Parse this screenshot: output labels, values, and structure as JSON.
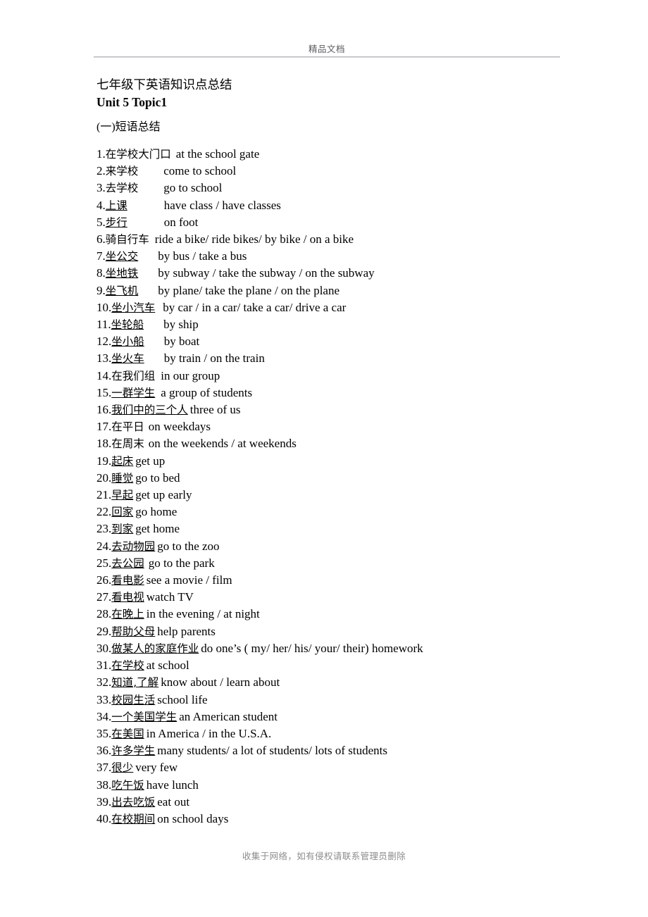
{
  "header": {
    "title": "精品文档"
  },
  "document": {
    "title": "七年级下英语知识点总结",
    "subtitle": "Unit 5 Topic1",
    "section_heading": "(一)短语总结"
  },
  "phrases": [
    {
      "num": "1.",
      "cn": "在学校大门口",
      "underline": false,
      "gap": 7,
      "en": "at the school gate"
    },
    {
      "num": "2.",
      "cn": "来学校",
      "underline": false,
      "gap": 36,
      "en": "come to school"
    },
    {
      "num": "3.",
      "cn": "去学校",
      "underline": false,
      "gap": 36,
      "en": "go to school"
    },
    {
      "num": "4.",
      "cn": "上课",
      "underline": true,
      "gap": 52,
      "en": "have class / have classes"
    },
    {
      "num": "5.",
      "cn": "步行",
      "underline": true,
      "gap": 52,
      "en": "on foot"
    },
    {
      "num": "6.",
      "cn": "骑自行车",
      "underline": false,
      "gap": 8,
      "en": "ride a bike/ ride bikes/ by bike / on a bike"
    },
    {
      "num": "7.",
      "cn": "坐公交",
      "underline": true,
      "gap": 28,
      "en": "by bus / take a bus"
    },
    {
      "num": "8.",
      "cn": "坐地铁",
      "underline": true,
      "gap": 28,
      "en": "by subway / take the subway / on the subway"
    },
    {
      "num": "9.",
      "cn": "坐飞机",
      "underline": true,
      "gap": 28,
      "en": "by plane/ take the plane / on the plane"
    },
    {
      "num": "10.",
      "cn": "坐小汽车",
      "underline": true,
      "gap": 11,
      "en": "by car / in a car/ take a car/ drive a car"
    },
    {
      "num": "11.",
      "cn": "坐轮船",
      "underline": true,
      "gap": 28,
      "en": "by ship"
    },
    {
      "num": "12.",
      "cn": "坐小船",
      "underline": true,
      "gap": 28,
      "en": "by boat"
    },
    {
      "num": "13.",
      "cn": "坐火车",
      "underline": true,
      "gap": 28,
      "en": "by train / on the train"
    },
    {
      "num": "14.",
      "cn": "在我们组",
      "underline": false,
      "gap": 8,
      "en": "in our group"
    },
    {
      "num": "15.",
      "cn": "一群学生",
      "underline": true,
      "gap": 8,
      "en": "a group of students"
    },
    {
      "num": "16.",
      "cn": "我们中的三个人",
      "underline": true,
      "gap": 3,
      "en": "three of us"
    },
    {
      "num": "17.",
      "cn": "在平日",
      "underline": false,
      "gap": 6,
      "en": "on weekdays"
    },
    {
      "num": "18.",
      "cn": "在周末",
      "underline": false,
      "gap": 6,
      "en": "on the weekends / at weekends"
    },
    {
      "num": "19.",
      "cn": "起床",
      "underline": true,
      "gap": 3,
      "en": "get up"
    },
    {
      "num": "20.",
      "cn": "睡觉",
      "underline": true,
      "gap": 3,
      "en": "go to bed"
    },
    {
      "num": "21.",
      "cn": "早起",
      "underline": true,
      "gap": 3,
      "en": "get up early"
    },
    {
      "num": "22.",
      "cn": "回家",
      "underline": true,
      "gap": 3,
      "en": "go home"
    },
    {
      "num": "23.",
      "cn": "到家",
      "underline": true,
      "gap": 3,
      "en": "get home"
    },
    {
      "num": "24.",
      "cn": "去动物园",
      "underline": true,
      "gap": 3,
      "en": "go to the zoo"
    },
    {
      "num": "25.",
      "cn": "去公园",
      "underline": true,
      "gap": 6,
      "en": "go to the park"
    },
    {
      "num": "26.",
      "cn": "看电影",
      "underline": true,
      "gap": 3,
      "en": "see a movie / film"
    },
    {
      "num": "27.",
      "cn": "看电视",
      "underline": true,
      "gap": 3,
      "en": "watch TV"
    },
    {
      "num": "28.",
      "cn": "在晚上",
      "underline": true,
      "gap": 3,
      "en": "in the evening / at night"
    },
    {
      "num": "29.",
      "cn": "帮助父母",
      "underline": true,
      "gap": 3,
      "en": "help parents"
    },
    {
      "num": "30.",
      "cn": "做某人的家庭作业",
      "underline": true,
      "gap": 3,
      "en": "do one’s ( my/ her/ his/ your/ their) homework"
    },
    {
      "num": "31.",
      "cn": "在学校",
      "underline": true,
      "gap": 3,
      "en": "at school"
    },
    {
      "num": "32.",
      "cn": "知道,了解",
      "underline": true,
      "gap": 3,
      "en": "know about / learn about"
    },
    {
      "num": "33.",
      "cn": "校园生活",
      "underline": true,
      "gap": 3,
      "en": "school life"
    },
    {
      "num": "34.",
      "cn": "一个美国学生",
      "underline": true,
      "gap": 3,
      "en": "an American student"
    },
    {
      "num": "35.",
      "cn": "在美国",
      "underline": true,
      "gap": 3,
      "en": "in America / in the U.S.A."
    },
    {
      "num": "36.",
      "cn": "许多学生",
      "underline": true,
      "gap": 3,
      "en": "many students/ a lot of students/ lots of students"
    },
    {
      "num": "37.",
      "cn": "很少",
      "underline": true,
      "gap": 3,
      "en": "very few"
    },
    {
      "num": "38.",
      "cn": "吃午饭",
      "underline": true,
      "gap": 3,
      "en": "have lunch"
    },
    {
      "num": "39.",
      "cn": "出去吃饭",
      "underline": true,
      "gap": 3,
      "en": "eat out"
    },
    {
      "num": "40.",
      "cn": "在校期间",
      "underline": true,
      "gap": 3,
      "en": "on school days"
    }
  ],
  "footer": {
    "text": "收集于网络，如有侵权请联系管理员删除"
  }
}
